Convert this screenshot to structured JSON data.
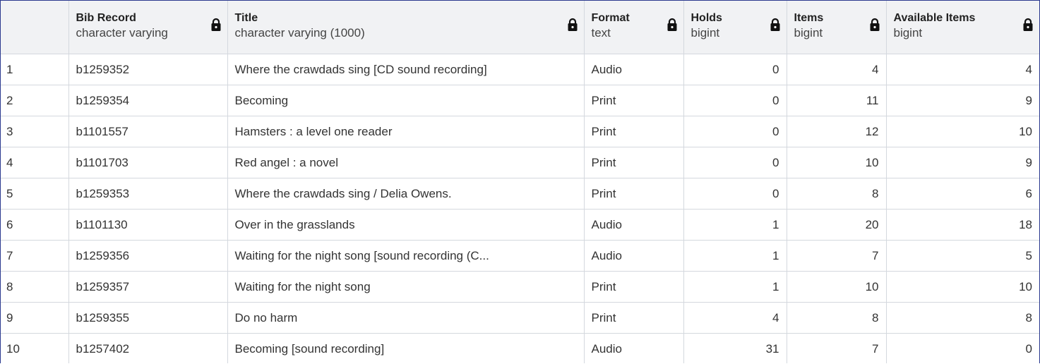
{
  "columns": [
    {
      "name": "",
      "type": "",
      "locked": false
    },
    {
      "name": "Bib Record",
      "type": "character varying",
      "locked": true
    },
    {
      "name": "Title",
      "type": "character varying (1000)",
      "locked": true
    },
    {
      "name": "Format",
      "type": "text",
      "locked": true
    },
    {
      "name": "Holds",
      "type": "bigint",
      "locked": true
    },
    {
      "name": "Items",
      "type": "bigint",
      "locked": true
    },
    {
      "name": "Available Items",
      "type": "bigint",
      "locked": true
    }
  ],
  "rows": [
    [
      "1",
      "b1259352",
      "Where the crawdads sing [CD sound recording]",
      "Audio",
      "0",
      "4",
      "4"
    ],
    [
      "2",
      "b1259354",
      "Becoming",
      "Print",
      "0",
      "11",
      "9"
    ],
    [
      "3",
      "b1101557",
      "Hamsters : a level one reader",
      "Print",
      "0",
      "12",
      "10"
    ],
    [
      "4",
      "b1101703",
      "Red angel : a novel",
      "Print",
      "0",
      "10",
      "9"
    ],
    [
      "5",
      "b1259353",
      "Where the crawdads sing / Delia Owens.",
      "Print",
      "0",
      "8",
      "6"
    ],
    [
      "6",
      "b1101130",
      "Over in the grasslands",
      "Audio",
      "1",
      "20",
      "18"
    ],
    [
      "7",
      "b1259356",
      "Waiting for the night song [sound recording (C...",
      "Audio",
      "1",
      "7",
      "5"
    ],
    [
      "8",
      "b1259357",
      "Waiting for the night song",
      "Print",
      "1",
      "10",
      "10"
    ],
    [
      "9",
      "b1259355",
      "Do no harm",
      "Print",
      "4",
      "8",
      "8"
    ],
    [
      "10",
      "b1257402",
      "Becoming [sound recording]",
      "Audio",
      "31",
      "7",
      "0"
    ]
  ],
  "icons": {
    "lock": "lock-icon"
  },
  "colors": {
    "frame_border": "#2b3a8f",
    "header_bg": "#f1f2f4",
    "grid_line": "#d4d8de"
  }
}
